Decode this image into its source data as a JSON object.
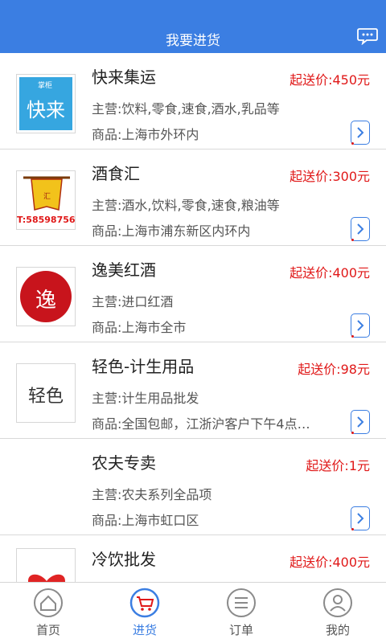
{
  "header": {
    "title": "我要进货"
  },
  "suppliers": [
    {
      "name": "快来集运",
      "price": "起送价:450元",
      "main": "主营:饮料,零食,速食,酒水,乳品等",
      "goods": "商品:上海市外环内",
      "logo_text": "快来",
      "logo_small": "掌柜"
    },
    {
      "name": "酒食汇",
      "price": "起送价:300元",
      "main": "主营:酒水,饮料,零食,速食,粮油等",
      "goods": "商品:上海市浦东新区内环内",
      "logo_text": "T:58598756"
    },
    {
      "name": "逸美红酒",
      "price": "起送价:400元",
      "main": "主营:进口红酒",
      "goods": "商品:上海市全市",
      "logo_text": "逸"
    },
    {
      "name": "轻色-计生用品",
      "price": "起送价:98元",
      "main": "主营:计生用品批发",
      "goods": "商品:全国包邮，江浙沪客户下午4点…",
      "logo_text": "轻色"
    },
    {
      "name": "农夫专卖",
      "price": "起送价:1元",
      "main": "主营:农夫系列全品项",
      "goods": "商品:上海市虹口区"
    },
    {
      "name": "冷饮批发",
      "price": "起送价:400元"
    }
  ],
  "tabs": [
    {
      "label": "首页",
      "icon": "home-icon"
    },
    {
      "label": "进货",
      "icon": "cart-icon"
    },
    {
      "label": "订单",
      "icon": "list-icon"
    },
    {
      "label": "我的",
      "icon": "user-icon"
    }
  ],
  "colors": {
    "primary": "#3b7ee2",
    "price": "#e01818"
  }
}
